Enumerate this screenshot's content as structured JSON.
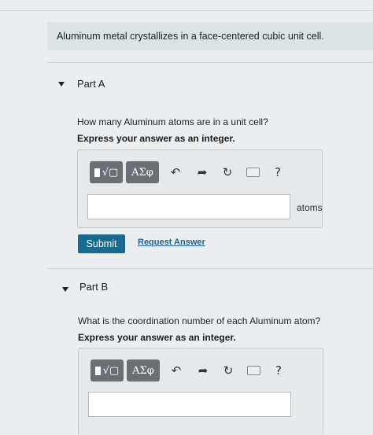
{
  "intro": {
    "text": "Aluminum metal crystallizes in a face-centered cubic unit cell."
  },
  "part_a": {
    "title": "Part A",
    "question": "How many Aluminum atoms are in a unit cell?",
    "instruction": "Express your answer as an integer.",
    "unit": "atoms",
    "answer_value": "",
    "submit_label": "Submit",
    "request_label": "Request Answer"
  },
  "part_b": {
    "title": "Part B",
    "question": "What is the coordination number of each Aluminum atom?",
    "instruction": "Express your answer as an integer.",
    "answer_value": ""
  },
  "toolbar": {
    "template_label": "√▢",
    "greek_label": "ΑΣφ",
    "help_label": "?"
  },
  "icons": [
    "caret-down-icon",
    "template-icon",
    "greek-symbols-icon",
    "undo-icon",
    "redo-icon",
    "reset-icon",
    "keyboard-icon",
    "help-icon"
  ],
  "colors": {
    "submit_bg": "#1a6a90",
    "link": "#1c5f98",
    "toolbar_btn": "#6b6f73",
    "intro_bg": "#dde3e5"
  }
}
